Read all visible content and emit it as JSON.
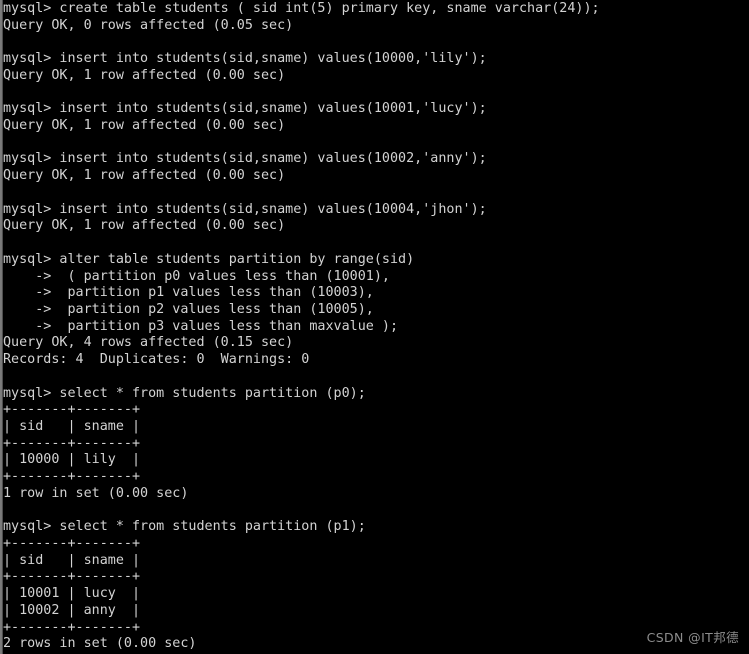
{
  "terminal": {
    "app": "mysql-client-console",
    "background_color": "#000000",
    "text_color": "#d3d3d3",
    "prompt": "mysql>",
    "continuation_prompt": "->",
    "lines": [
      "mysql> create table students ( sid int(5) primary key, sname varchar(24));",
      "Query OK, 0 rows affected (0.05 sec)",
      "",
      "mysql> insert into students(sid,sname) values(10000,'lily');",
      "Query OK, 1 row affected (0.00 sec)",
      "",
      "mysql> insert into students(sid,sname) values(10001,'lucy');",
      "Query OK, 1 row affected (0.00 sec)",
      "",
      "mysql> insert into students(sid,sname) values(10002,'anny');",
      "Query OK, 1 row affected (0.00 sec)",
      "",
      "mysql> insert into students(sid,sname) values(10004,'jhon');",
      "Query OK, 1 row affected (0.00 sec)",
      "",
      "mysql> alter table students partition by range(sid)",
      "    ->  ( partition p0 values less than (10001),",
      "    ->  partition p1 values less than (10003),",
      "    ->  partition p2 values less than (10005),",
      "    ->  partition p3 values less than maxvalue );",
      "Query OK, 4 rows affected (0.15 sec)",
      "Records: 4  Duplicates: 0  Warnings: 0",
      "",
      "mysql> select * from students partition (p0);",
      "+-------+-------+",
      "| sid   | sname |",
      "+-------+-------+",
      "| 10000 | lily  |",
      "+-------+-------+",
      "1 row in set (0.00 sec)",
      "",
      "mysql> select * from students partition (p1);",
      "+-------+-------+",
      "| sid   | sname |",
      "+-------+-------+",
      "| 10001 | lucy  |",
      "| 10002 | anny  |",
      "+-------+-------+",
      "2 rows in set (0.00 sec)"
    ],
    "commands": [
      {
        "sql": "create table students ( sid int(5) primary key, sname varchar(24));",
        "result": "Query OK, 0 rows affected (0.05 sec)"
      },
      {
        "sql": "insert into students(sid,sname) values(10000,'lily');",
        "result": "Query OK, 1 row affected (0.00 sec)"
      },
      {
        "sql": "insert into students(sid,sname) values(10001,'lucy');",
        "result": "Query OK, 1 row affected (0.00 sec)"
      },
      {
        "sql": "insert into students(sid,sname) values(10002,'anny');",
        "result": "Query OK, 1 row affected (0.00 sec)"
      },
      {
        "sql": "insert into students(sid,sname) values(10004,'jhon');",
        "result": "Query OK, 1 row affected (0.00 sec)"
      },
      {
        "sql": "alter table students partition by range(sid)",
        "result": "Query OK, 4 rows affected (0.15 sec)"
      },
      {
        "sql": "select * from students partition (p0);",
        "result": "1 row in set (0.00 sec)"
      },
      {
        "sql": "select * from students partition (p1);",
        "result": "2 rows in set (0.00 sec)"
      }
    ],
    "result_tables": [
      {
        "partition": "p0",
        "columns": [
          "sid",
          "sname"
        ],
        "rows": [
          [
            "10000",
            "lily"
          ]
        ],
        "row_count_text": "1 row in set (0.00 sec)"
      },
      {
        "partition": "p1",
        "columns": [
          "sid",
          "sname"
        ],
        "rows": [
          [
            "10001",
            "lucy"
          ],
          [
            "10002",
            "anny"
          ]
        ],
        "row_count_text": "2 rows in set (0.00 sec)"
      }
    ],
    "partitions": [
      {
        "name": "p0",
        "less_than": "10001"
      },
      {
        "name": "p1",
        "less_than": "10003"
      },
      {
        "name": "p2",
        "less_than": "10005"
      },
      {
        "name": "p3",
        "less_than": "maxvalue"
      }
    ],
    "alter_summary": {
      "status": "Query OK, 4 rows affected (0.15 sec)",
      "records": "Records: 4  Duplicates: 0  Warnings: 0"
    }
  },
  "watermark": {
    "text": "CSDN @IT邦德",
    "color": "#8d8d8d"
  }
}
